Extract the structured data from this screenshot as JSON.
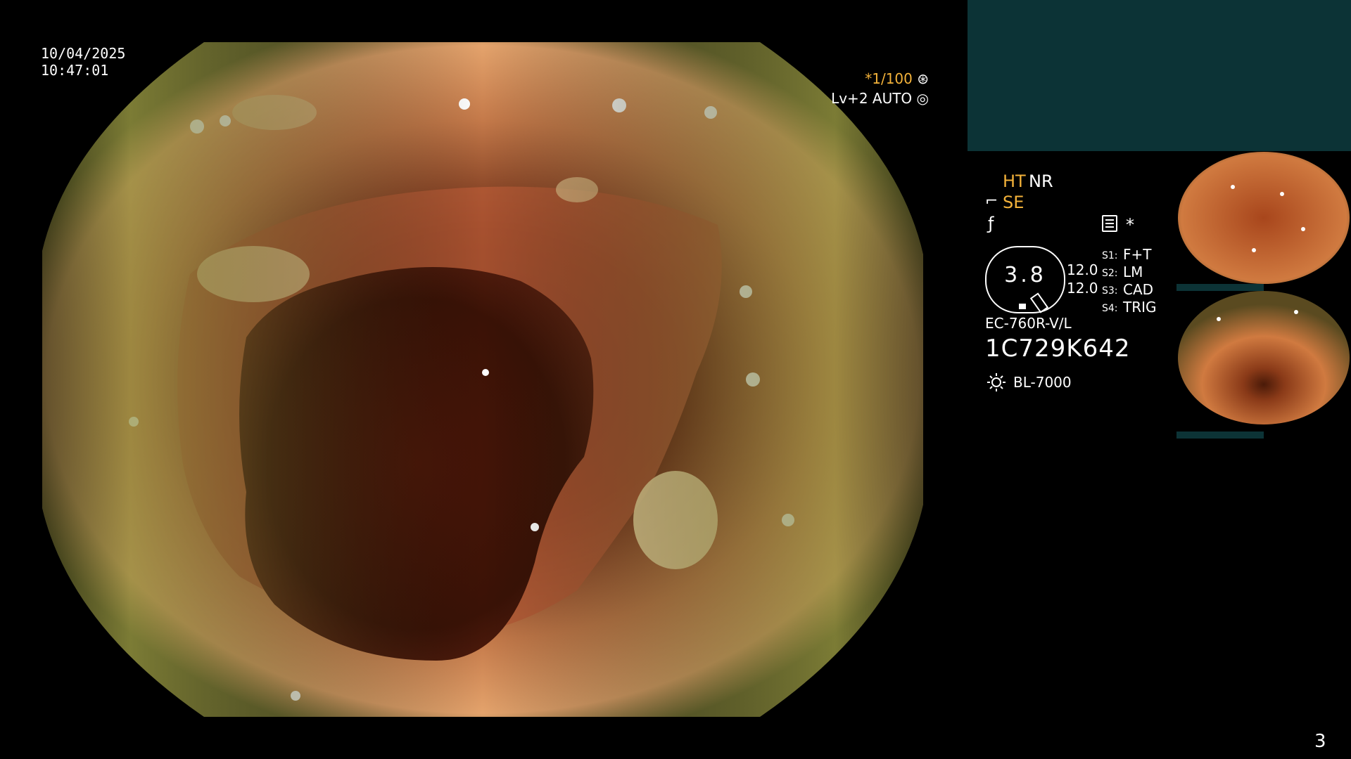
{
  "overlay": {
    "date": "10/04/2025",
    "time": "10:47:01",
    "shutter": "*1/100",
    "exposure": "Lv+2 AUTO"
  },
  "status": {
    "ht": "HT",
    "nr": "NR",
    "se": "SE",
    "dial_value": "3.8",
    "value_1": "12.0",
    "value_2": "12.0",
    "switches": [
      {
        "label": "S1:",
        "value": "F+T"
      },
      {
        "label": "S2:",
        "value": "LM"
      },
      {
        "label": "S3:",
        "value": "CAD"
      },
      {
        "label": "S4:",
        "value": "TRIG"
      }
    ],
    "star": "*"
  },
  "device": {
    "scope_model": "EC-760R-V/L",
    "serial": "1C729K642",
    "light_source": "BL-7000"
  },
  "page_number": "3",
  "colors": {
    "accent_orange": "#f3b23a",
    "panel_teal": "#0c3336"
  },
  "icons": [
    "shutter-icon",
    "auto-exposure-icon",
    "structure-enhance-icon",
    "freeze-icon",
    "settings-icon",
    "light-source-icon"
  ]
}
